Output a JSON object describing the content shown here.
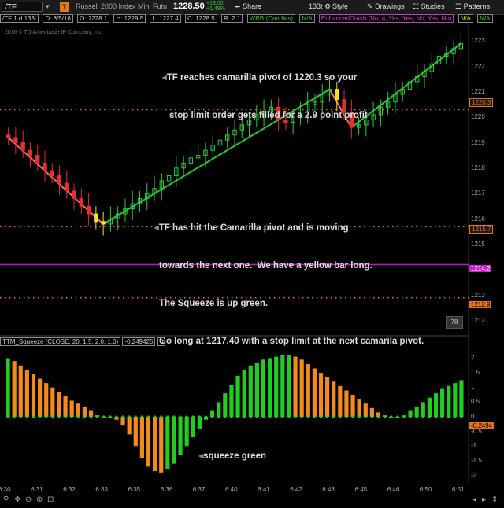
{
  "toolbar": {
    "symbol": "/TF",
    "indicator_badge": "7",
    "instrument_name": "Russell 2000 Index Mini Futu...",
    "last_price": "1228.50",
    "change_top": "+18.00",
    "change_bottom": "+1.49%",
    "share": "Share",
    "interval": "133t",
    "style": "Style",
    "drawings": "Drawings",
    "studies": "Studies",
    "patterns": "Patterns"
  },
  "infobar": {
    "symbol": "/TF 1 d 133t",
    "date": "D: 8/5/16",
    "open": "O: 1228.1",
    "high": "H: 1229.5",
    "low": "L: 1227.4",
    "close": "C: 1228.5",
    "range": "R: 2.1",
    "study1": "WRB (Candles)",
    "study1_value": "N/A",
    "study2": "EnhancedCrash (No, 4, Yes, Yes, No, Yes, No)",
    "study2_value": "N/A",
    "study3_value": "N/A"
  },
  "copyright": "2016 © TD Ameritrade IP Company, Inc.",
  "annotations": {
    "top_line1": "TF reaches camarilla pivot of 1220.3 so your",
    "top_line2": "stop limit order gets filled for a 2.9 point profit",
    "mid_line1": "TF has hit the Camarilla pivot and is moving",
    "mid_line2": "towards the next one.  We have a yellow bar long.",
    "mid_line3": "The Squeeze is up green.",
    "mid_line4": "Go long at 1217.40 with a stop limit at the next camarila pivot.",
    "lower": "squeeze green"
  },
  "price_axis": [
    "1223",
    "1222",
    "1221",
    "1220",
    "1219",
    "1218",
    "1217",
    "1216",
    "1215",
    "1214",
    "1213",
    "1212"
  ],
  "price_tags": {
    "pivot_upper": "1220.3",
    "pivot_lower": "1215.7",
    "magenta_line": "1214.2",
    "pivot_bottom": "1212.9"
  },
  "bar_count_badge": "78",
  "lower_study": {
    "name": "TTM_Squeeze (CLOSE, 20, 1.5, 2.0, 1.0)",
    "value": "-0.249425",
    "extra": "0",
    "value_tag": "-0.2494",
    "axis": [
      "2",
      "1.5",
      "1",
      "0.5",
      "0",
      "-0.5",
      "-1",
      "-1.5",
      "-2"
    ]
  },
  "time_axis": [
    "6:30",
    "6:31",
    "6:32",
    "6:33",
    "6:35",
    "6:36",
    "6:37",
    "6:40",
    "6:41",
    "6:42",
    "6:43",
    "6:45",
    "6:46",
    "6:50",
    "6:51"
  ],
  "colors": {
    "up_candle": "#2ecc40",
    "down_candle": "#e03030",
    "signal_candle": "#f5e51b",
    "trend_up": "#22cc22",
    "trend_down": "#ff6666",
    "pivot_dots": "#e8701a",
    "squeeze_pos": "#22cc22",
    "squeeze_neg": "#f28a1c",
    "squeeze_dot": "#22cc22"
  },
  "chart_data": [
    {
      "type": "candlestick",
      "title": "/TF 1 d 133t",
      "ylim": [
        1211.5,
        1223.5
      ],
      "pivot_lines": [
        1220.3,
        1215.7,
        1212.9
      ],
      "magenta_line": 1214.2,
      "close_values": [
        1219.2,
        1219.0,
        1218.7,
        1218.5,
        1218.2,
        1217.9,
        1217.7,
        1217.4,
        1217.1,
        1216.8,
        1216.5,
        1216.2,
        1215.9,
        1215.8,
        1216.0,
        1216.2,
        1216.4,
        1216.6,
        1216.8,
        1217.0,
        1217.2,
        1217.5,
        1217.7,
        1218.0,
        1218.2,
        1218.4,
        1218.5,
        1218.7,
        1218.9,
        1219.1,
        1219.3,
        1219.5,
        1219.7,
        1219.9,
        1220.1,
        1220.2,
        1220.4,
        1219.9,
        1219.8,
        1220.0,
        1220.2,
        1220.5,
        1220.6,
        1220.9,
        1221.1,
        1220.7,
        1220.2,
        1219.6,
        1219.7,
        1219.9,
        1220.1,
        1220.4,
        1220.6,
        1220.9,
        1221.1,
        1221.4,
        1221.6,
        1221.8,
        1222.1,
        1222.4,
        1222.5,
        1222.7,
        1222.9
      ]
    },
    {
      "type": "bar",
      "title": "TTM_Squeeze (CLOSE, 20, 1.5, 2.0, 1.0)",
      "ylim": [
        -2.2,
        2.2
      ],
      "values": [
        2.0,
        1.9,
        1.75,
        1.6,
        1.45,
        1.3,
        1.15,
        1.0,
        0.85,
        0.7,
        0.55,
        0.45,
        0.35,
        0.2,
        0.05,
        0.0,
        0.0,
        -0.1,
        -0.3,
        -0.6,
        -1.0,
        -1.4,
        -1.7,
        -1.85,
        -1.9,
        -1.8,
        -1.6,
        -1.3,
        -1.0,
        -0.7,
        -0.4,
        -0.1,
        0.2,
        0.5,
        0.8,
        1.1,
        1.4,
        1.6,
        1.75,
        1.85,
        1.95,
        2.0,
        2.05,
        2.1,
        2.1,
        2.05,
        1.95,
        1.8,
        1.65,
        1.5,
        1.35,
        1.2,
        1.05,
        0.9,
        0.75,
        0.6,
        0.45,
        0.3,
        0.15,
        0.05,
        0.0,
        0.0,
        0.05,
        0.2,
        0.35,
        0.5,
        0.65,
        0.8,
        0.95,
        1.05,
        1.15,
        1.25
      ],
      "squeeze_dots": "green"
    }
  ]
}
